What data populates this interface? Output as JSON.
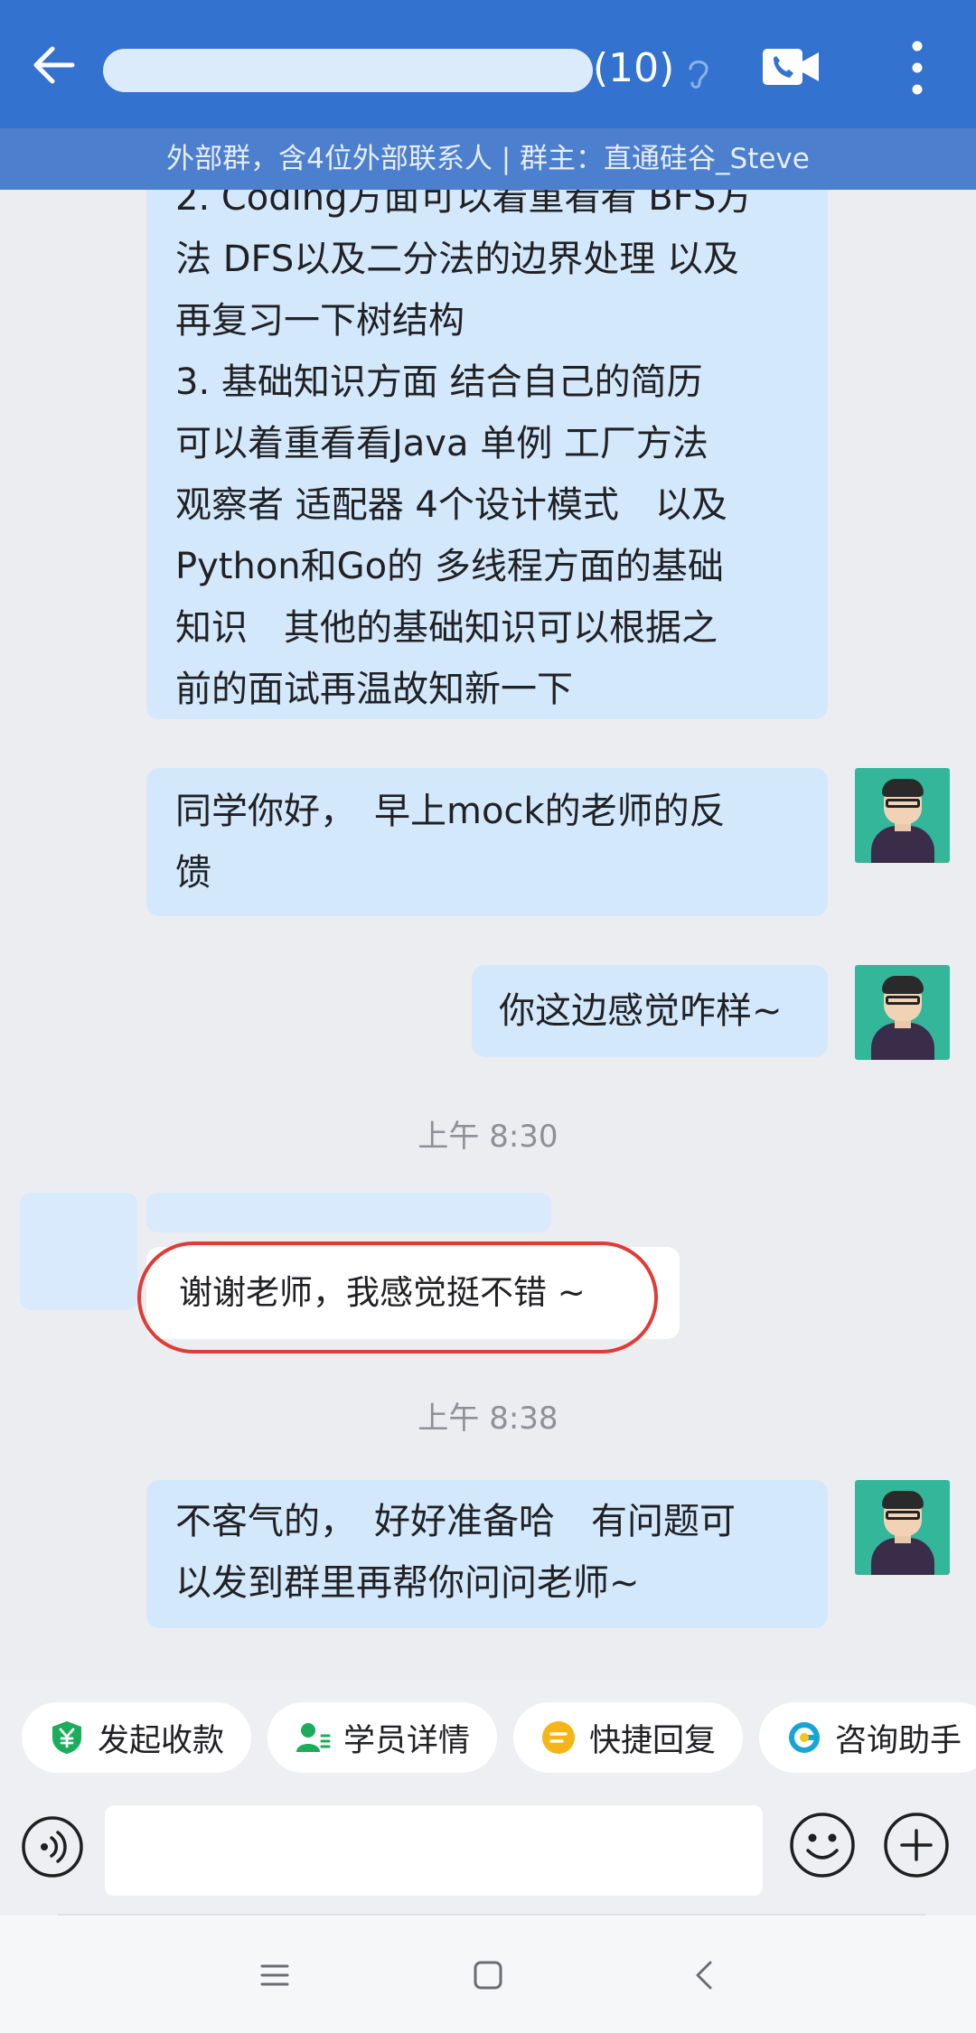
{
  "header": {
    "title_count": "(10)",
    "subtitle": "外部群，含4位外部联系人 | 群主：直通硅谷_Steve"
  },
  "messages": {
    "m1": {
      "lines": [
        "2. Coding方面可以着重看看 BFS方",
        "法 DFS以及二分法的边界处理 以及",
        "再复习一下树结构",
        "3. 基础知识方面 结合自己的简历",
        "可以着重看看Java 单例 工厂方法",
        "观察者 适配器 4个设计模式　以及",
        "Python和Go的 多线程方面的基础",
        "知识　其他的基础知识可以根据之",
        "前的面试再温故知新一下"
      ]
    },
    "m2": {
      "lines": [
        "同学你好，　早上mock的老师的反",
        "馈"
      ]
    },
    "m3": {
      "text": "你这边感觉咋样~"
    },
    "ts1": "上午 8:30",
    "m4": {
      "text": "谢谢老师，我感觉挺不错 ~"
    },
    "ts2": "上午 8:38",
    "m5": {
      "lines": [
        "不客气的，　好好准备哈　有问题可",
        "以发到群里再帮你问问老师~"
      ]
    }
  },
  "quick_actions": [
    {
      "label": "发起收款",
      "icon": "payment-shield-icon",
      "color": "#1aad5a"
    },
    {
      "label": "学员详情",
      "icon": "student-profile-icon",
      "color": "#1aad5a"
    },
    {
      "label": "快捷回复",
      "icon": "quick-reply-icon",
      "color": "#f5b418"
    },
    {
      "label": "咨询助手",
      "icon": "consult-assistant-icon",
      "color": "#17a5d8"
    }
  ],
  "composer": {
    "value": "",
    "placeholder": ""
  },
  "colors": {
    "header": "#3472cf",
    "subbar": "#4c7fce",
    "sent_bubble": "#d4e8fc",
    "highlight_circle": "#e03b35"
  }
}
